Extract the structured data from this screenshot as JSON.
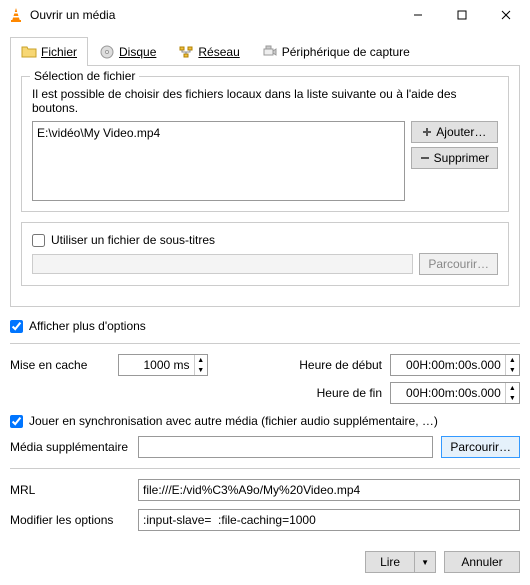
{
  "window": {
    "title": "Ouvrir un média"
  },
  "tabs": {
    "file": "Fichier",
    "disc": "Disque",
    "network": "Réseau",
    "capture": "Périphérique de capture"
  },
  "fileGroup": {
    "legend": "Sélection de fichier",
    "hint": "Il est possible de choisir des fichiers locaux dans la liste suivante ou à l'aide des boutons.",
    "selected": "E:\\vidéo\\My Video.mp4",
    "add": "Ajouter…",
    "remove": "Supprimer"
  },
  "subs": {
    "use": "Utiliser un fichier de sous-titres",
    "browse": "Parcourir…"
  },
  "more": {
    "label": "Afficher plus d'options"
  },
  "opts": {
    "cacheLabel": "Mise en cache",
    "cacheValue": "1000 ms",
    "startLabel": "Heure de début",
    "startValue": "00H:00m:00s.000",
    "endLabel": "Heure de fin",
    "endValue": "00H:00m:00s.000",
    "sync": "Jouer en synchronisation avec autre média (fichier audio supplémentaire, …)",
    "extraLabel": "Média supplémentaire",
    "extraBrowse": "Parcourir…",
    "mrlLabel": "MRL",
    "mrlValue": "file:///E:/vid%C3%A9o/My%20Video.mp4",
    "editLabel": "Modifier les options",
    "editValue": ":input-slave=  :file-caching=1000"
  },
  "footer": {
    "play": "Lire",
    "cancel": "Annuler"
  }
}
